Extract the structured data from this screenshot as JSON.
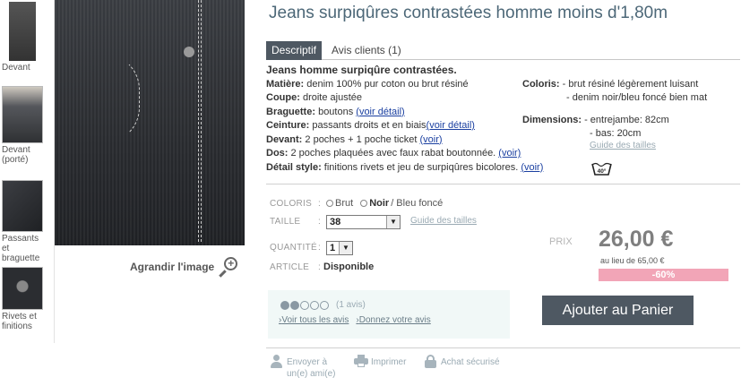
{
  "thumbnails": [
    {
      "caption": "Devant"
    },
    {
      "caption": "Devant (porté)"
    },
    {
      "caption": "Passants et braguette"
    },
    {
      "caption": "Rivets et finitions"
    }
  ],
  "zoom_label": "Agrandir l'image",
  "product_title": "Jeans surpiqûres contrastées homme moins d'1,80m",
  "tabs": [
    {
      "label": "Descriptif"
    },
    {
      "label": "Avis clients (1)"
    }
  ],
  "description": {
    "headline": "Jeans homme surpiqûre contrastées.",
    "matiere_label": "Matière:",
    "matiere_value": " denim 100% pur coton ou brut résiné",
    "coupe_label": "Coupe:",
    "coupe_value": " droite ajustée",
    "braguette_label": "Braguette:",
    "braguette_value": " boutons ",
    "ceinture_label": "Ceinture:",
    "ceinture_value": " passants droits et en biais",
    "devant_label": "Devant:",
    "devant_value": " 2 poches + 1 poche ticket ",
    "dos_label": "Dos:",
    "dos_value": " 2 poches plaquées avec faux rabat boutonnée. ",
    "detail_label": "Détail style:",
    "detail_value": " finitions rivets et jeu de surpiqûres bicolores. ",
    "link_voir_detail": "(voir détail)",
    "link_voir": "(voir)"
  },
  "specs": {
    "coloris_label": "Coloris:",
    "coloris_1": " - brut résiné légèrement luisant",
    "coloris_2": "- denim noir/bleu foncé bien mat",
    "dimensions_label": "Dimensions:",
    "dimensions_1": " - entrejambe: 82cm",
    "dimensions_2": "- bas: 20cm",
    "guide_link": "Guide des tailles",
    "wash_label": "40°"
  },
  "options": {
    "coloris_label": "COLORIS",
    "colon": ":",
    "color_options": [
      "Brut",
      "Noir"
    ],
    "selected_color_suffix": " / Bleu foncé",
    "taille_label": "TAILLE",
    "taille_value": "38",
    "size_guide_link": "Guide des tailles",
    "quantite_label": "QUANTITÉ",
    "quantite_value": "1",
    "article_label": "ARTICLE",
    "stock_value": "Disponible"
  },
  "pricing": {
    "prix_label": "PRIX",
    "price": "26,00 €",
    "old_price": "au lieu de  65,00 €",
    "discount": "-60%"
  },
  "rating": {
    "score": 2,
    "max": 5,
    "count": "(1 avis)",
    "link_all": "Voir tous les avis",
    "link_give": "Donnez votre avis"
  },
  "cart_button": "Ajouter au Panier",
  "footer": {
    "send_friend_line1": "Envoyer à",
    "send_friend_line2": "un(e) ami(e)",
    "print": "Imprimer",
    "secure": "Achat sécurisé"
  },
  "colors": {
    "title": "#4d6878",
    "tab_active": "#4e5862",
    "cart_button": "#4e5862",
    "discount_bg": "#f2a5b7",
    "link": "#1a3fa0"
  }
}
